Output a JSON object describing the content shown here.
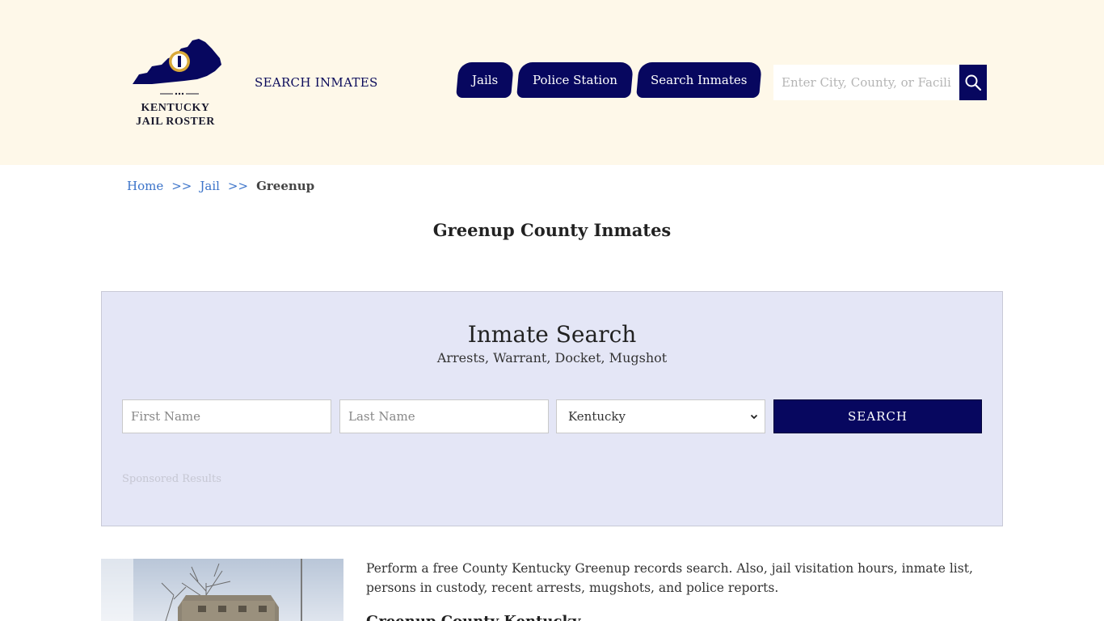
{
  "header": {
    "logo_line1": "KENTUCKY",
    "logo_line2": "JAIL ROSTER",
    "search_inmates_link": "SEARCH INMATES",
    "nav": {
      "jails": "Jails",
      "police_station": "Police Station",
      "search_inmates": "Search Inmates"
    },
    "site_search_placeholder": "Enter City, County, or Facility"
  },
  "breadcrumb": {
    "home": "Home",
    "separator": ">>",
    "jail": "Jail",
    "current": "Greenup"
  },
  "page_title": "Greenup County Inmates",
  "inmate_search": {
    "title": "Inmate Search",
    "subtitle": "Arrests, Warrant, Docket, Mugshot",
    "first_name_placeholder": "First Name",
    "last_name_placeholder": "Last Name",
    "state_selected": "Kentucky",
    "submit_label": "SEARCH",
    "sponsored": "Sponsored Results"
  },
  "content": {
    "intro": "Perform a free County Kentucky Greenup records search. Also, jail visitation hours, inmate list, persons in custody, recent arrests, mugshots, and police reports.",
    "subhead": "Greenup County Kentucky"
  },
  "colors": {
    "header_bg": "#fef8e9",
    "navy": "#07075f",
    "link_blue": "#3b73c9",
    "search_box_bg": "#e4e6f6"
  }
}
